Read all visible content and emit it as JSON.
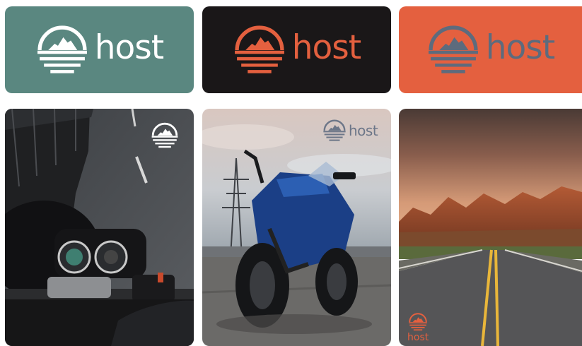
{
  "brand": {
    "wordmark": "host",
    "colors": {
      "teal": "#5a8780",
      "black": "#1a1718",
      "orange": "#e4603f",
      "white": "#ffffff",
      "slate": "#5d6b7d"
    }
  },
  "logo_cards": [
    {
      "background": "#5a8780",
      "mark_color": "#ffffff",
      "word_color": "#ffffff",
      "word": "host"
    },
    {
      "background": "#1a1718",
      "mark_color": "#e4603f",
      "word_color": "#e4603f",
      "word": "host"
    },
    {
      "background": "#e4603f",
      "mark_color": "#5d6b7d",
      "word_color": "#5d6b7d",
      "word": "host"
    }
  ],
  "photo_cards": [
    {
      "scene": "motorcycle-cockpit-on-road",
      "logo": "mark-only",
      "logo_color": "#ffffff"
    },
    {
      "scene": "blue-sport-motorcycle",
      "logo": "mark-and-word",
      "logo_color": "#6c7688",
      "word": "host"
    },
    {
      "scene": "desert-highway-sunset",
      "logo": "stacked-mark-word",
      "logo_color": "#e4603f",
      "word": "host"
    }
  ]
}
